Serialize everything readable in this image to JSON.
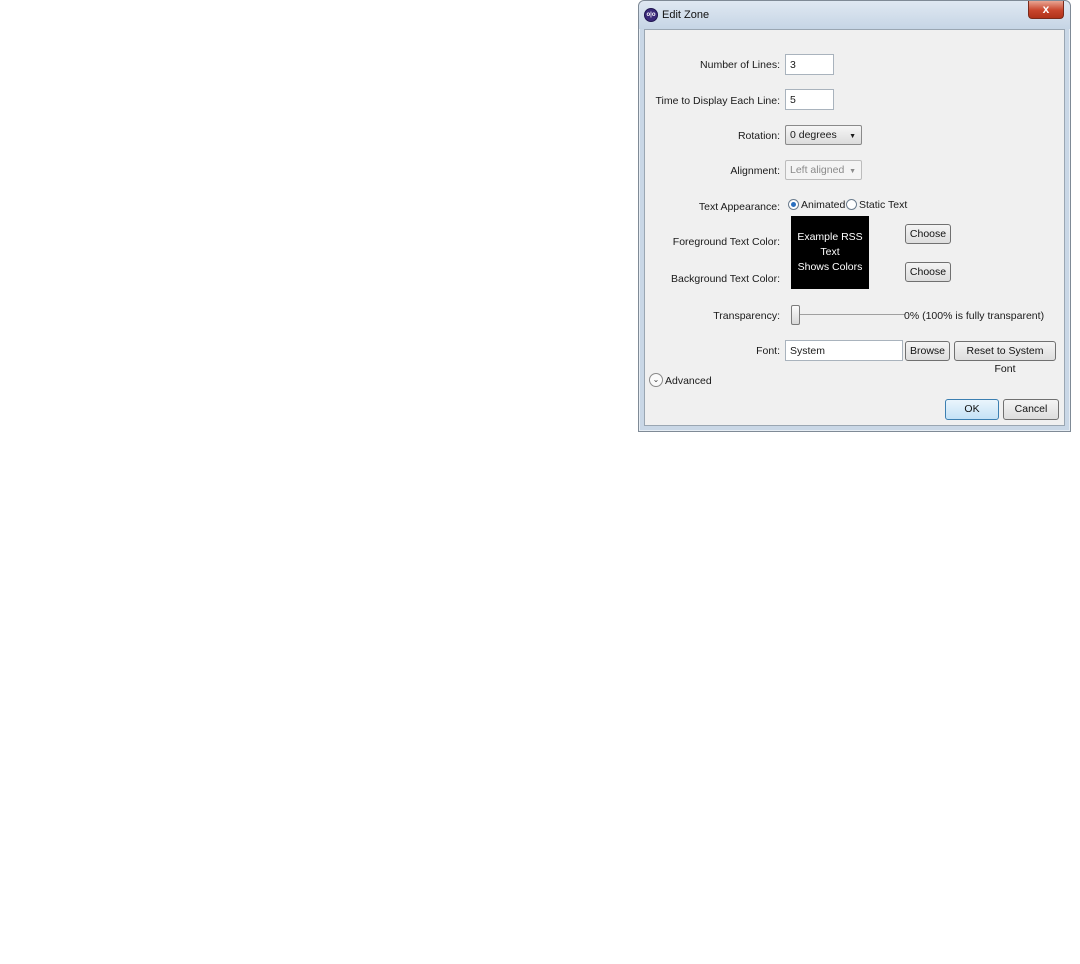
{
  "window": {
    "title": "Edit Zone",
    "app_icon_text": "o|o",
    "close_glyph": "x"
  },
  "form": {
    "number_of_lines": {
      "label": "Number of Lines:",
      "value": "3"
    },
    "time_to_display": {
      "label": "Time to Display Each Line:",
      "value": "5"
    },
    "rotation": {
      "label": "Rotation:",
      "selected": "0 degrees"
    },
    "alignment": {
      "label": "Alignment:",
      "selected": "Left aligned",
      "disabled": true
    },
    "text_appearance": {
      "label": "Text Appearance:",
      "options": [
        "Animated",
        "Static Text"
      ],
      "selected": "Animated"
    },
    "foreground_color": {
      "label": "Foreground Text Color:",
      "button": "Choose",
      "color": "#ffffff"
    },
    "background_color": {
      "label": "Background Text Color:",
      "button": "Choose",
      "color": "#000000"
    },
    "preview": {
      "line1": "Example RSS Text",
      "line2": "Shows Colors"
    },
    "transparency": {
      "label": "Transparency:",
      "value_text": "0% (100% is fully transparent)",
      "value": 0
    },
    "font": {
      "label": "Font:",
      "value": "System",
      "browse": "Browse",
      "reset": "Reset to System Font"
    }
  },
  "advanced": {
    "label": "Advanced"
  },
  "footer": {
    "ok": "OK",
    "cancel": "Cancel"
  }
}
